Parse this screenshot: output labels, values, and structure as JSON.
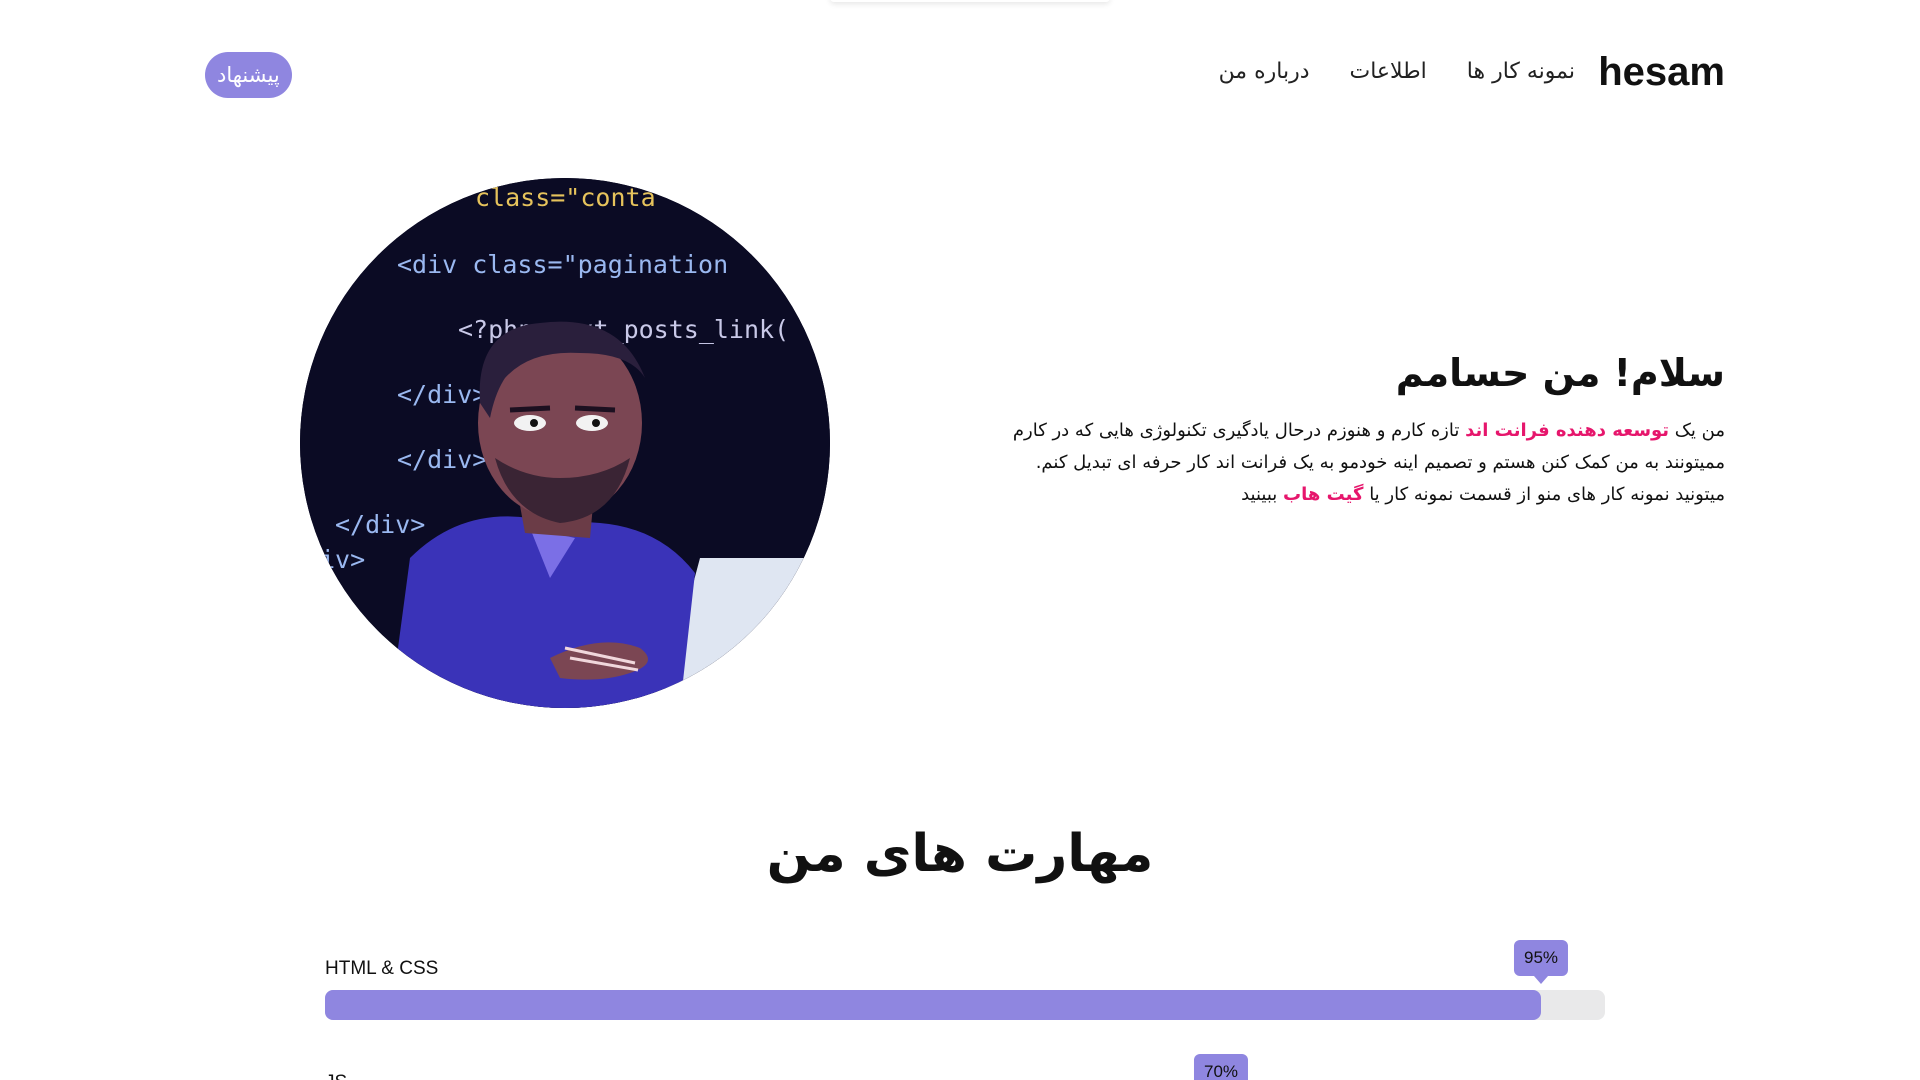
{
  "header": {
    "brand": "hesam",
    "nav": [
      "درباره من",
      "اطلاعات",
      "نمونه کار ها"
    ],
    "cta_label": "پیشنهاد"
  },
  "hero": {
    "avatar_icon": "developer-illustration",
    "code_lines": [
      "class=\"conta",
      "<div class=\"pagination",
      "<?php next_posts_link(",
      "</div>",
      "</div>",
      "</div>",
      "iv>"
    ],
    "title": "سلام! من حسامم",
    "desc_part1": "من یک ",
    "desc_highlight1": "توسعه دهنده فرانت اند",
    "desc_part2": " تازه کارم و هنوزم درحال یادگیری تکنولوژی هایی که در کارم مميتونند به من کمک کنن هستم و تصمیم اینه خودمو به یک فرانت اند کار حرفه ای تبدیل کنم. میتونید نمونه کار های منو از قسمت نمونه کار یا ",
    "desc_highlight2": "گیت هاب",
    "desc_part3": " ببینید"
  },
  "skills": {
    "title": "مهارت های من",
    "items": [
      {
        "label": "HTML & CSS",
        "percent_label": "95%",
        "value": 95
      },
      {
        "label": "JS",
        "percent_label": "70%",
        "value": 70
      }
    ]
  },
  "colors": {
    "accent": "#8f86e0",
    "highlight": "#e6166c"
  }
}
